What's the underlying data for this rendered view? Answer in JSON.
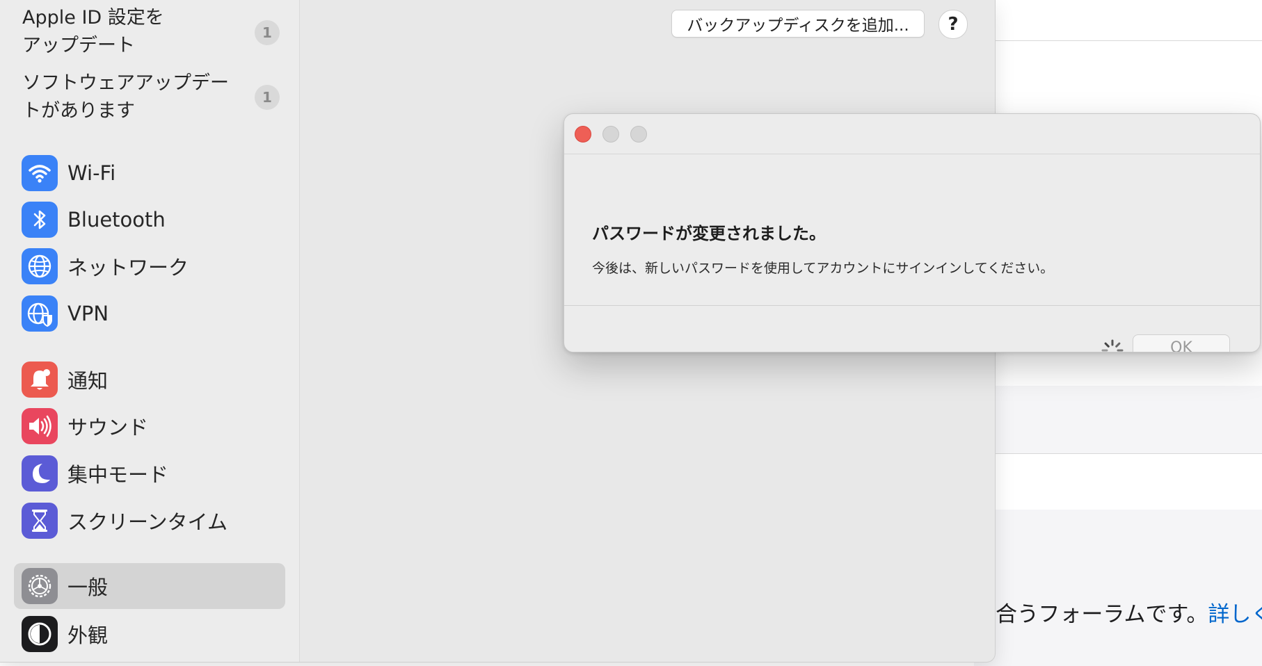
{
  "background_page": {
    "forum_text": "け合うフォーラムです。",
    "forum_link": "詳しくは"
  },
  "sidebar": {
    "updates": [
      {
        "label_line1": "Apple ID 設定を",
        "label_line2": "アップデート",
        "badge": "1"
      },
      {
        "label_line1": "ソフトウェアアップデー",
        "label_line2": "トがあります",
        "badge": "1"
      }
    ],
    "items": [
      {
        "label": "Wi-Fi",
        "icon": "wifi-icon",
        "color": "#3a82f7"
      },
      {
        "label": "Bluetooth",
        "icon": "bluetooth-icon",
        "color": "#3a82f7"
      },
      {
        "label": "ネットワーク",
        "icon": "globe-icon",
        "color": "#3a82f7"
      },
      {
        "label": "VPN",
        "icon": "vpn-globe-icon",
        "color": "#3a82f7"
      },
      {
        "label": "通知",
        "icon": "bell-icon",
        "color": "#ec5a4f"
      },
      {
        "label": "サウンド",
        "icon": "speaker-icon",
        "color": "#e9465e"
      },
      {
        "label": "集中モード",
        "icon": "moon-icon",
        "color": "#5b5bd6"
      },
      {
        "label": "スクリーンタイム",
        "icon": "hourglass-icon",
        "color": "#5b5bd6"
      },
      {
        "label": "一般",
        "icon": "gear-icon",
        "color": "#8e8e93",
        "selected": true
      },
      {
        "label": "外観",
        "icon": "appearance-icon",
        "color": "#1c1c1e"
      }
    ]
  },
  "toolbar": {
    "add_backup_disk_label": "バックアップディスクを追加...",
    "help_label": "?"
  },
  "dialog": {
    "title": "パスワードが変更されました。",
    "message": "今後は、新しいパスワードを使用してアカウントにサインインしてください。",
    "ok_label": "OK"
  }
}
